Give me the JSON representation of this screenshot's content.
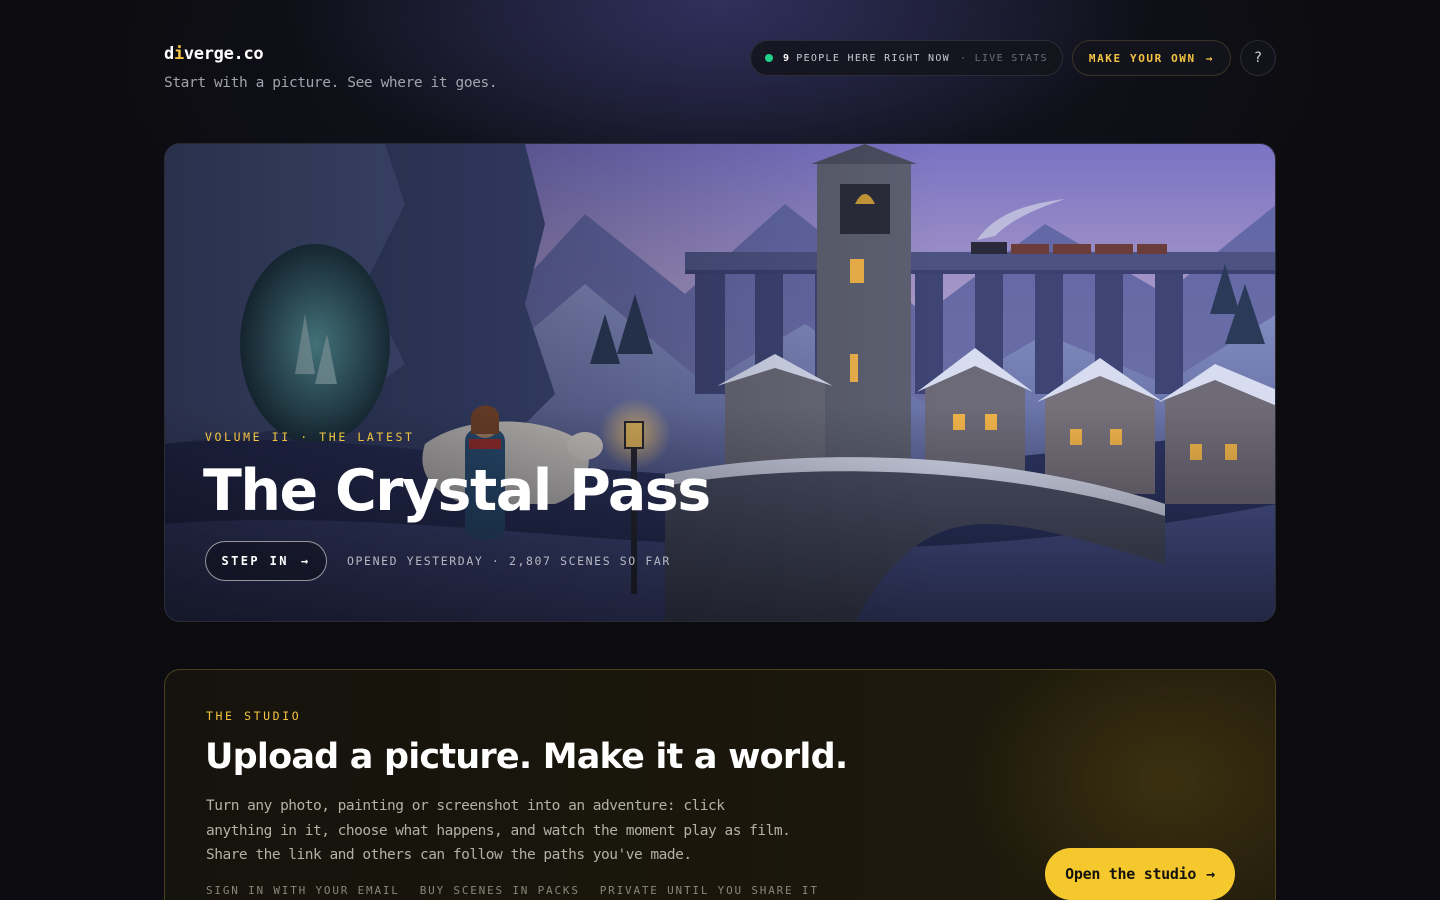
{
  "brand": {
    "logo_prefix": "d",
    "logo_mark": "i",
    "logo_suffix": "verge.co",
    "tagline": "Start with a picture. See where it goes."
  },
  "header": {
    "live_count": "9",
    "live_label": "PEOPLE HERE RIGHT NOW",
    "live_stats": "· LIVE STATS",
    "make_label": "MAKE YOUR OWN",
    "make_arrow": "→",
    "help_label": "?"
  },
  "hero": {
    "kicker": "VOLUME II · THE LATEST",
    "title": "The Crystal Pass",
    "cta_label": "STEP IN",
    "cta_arrow": "→",
    "meta": "OPENED YESTERDAY · 2,807 SCENES SO FAR"
  },
  "studio": {
    "kicker": "THE STUDIO",
    "title": "Upload a picture. Make it a world.",
    "body": "Turn any photo, painting or screenshot into an adventure: click anything in it, choose what happens, and watch the moment play as film. Share the link and others can follow the paths you've made.",
    "features": [
      "SIGN IN WITH YOUR EMAIL",
      "BUY SCENES IN PACKS",
      "PRIVATE UNTIL YOU SHARE IT"
    ],
    "cta_label": "Open the studio",
    "cta_arrow": "→"
  },
  "colors": {
    "accent": "#f4c542",
    "live_dot": "#22d08a",
    "background": "#0c0c10"
  }
}
